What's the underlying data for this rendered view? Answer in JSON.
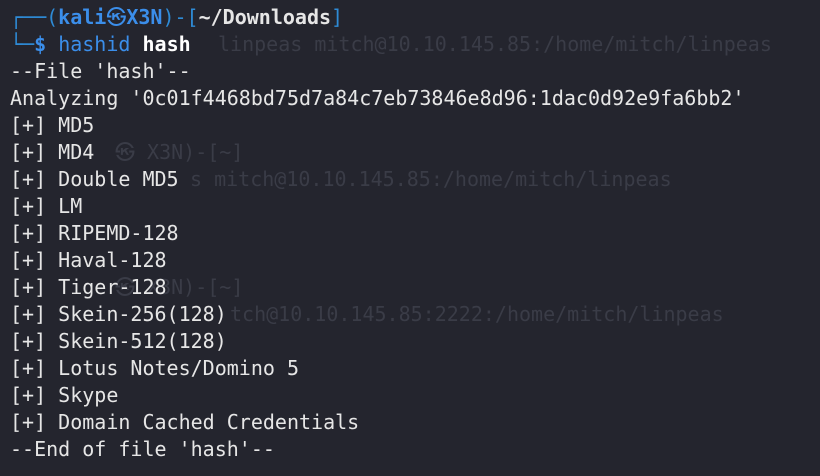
{
  "prompt": {
    "frame_top": "┌──(",
    "user": "kali",
    "at_symbol": "㉿",
    "host": "X3N",
    "frame_mid": ")-[",
    "path": "~/Downloads",
    "frame_end": "]",
    "frame_bottom": "└─",
    "dollar": "$",
    "command": "hashid",
    "argument": "hash"
  },
  "output": {
    "file_header": "--File 'hash'--",
    "analyzing": "Analyzing '0c01f4468bd75d7a84c7eb73846e8d96:1dac0d92e9fa6bb2'",
    "marker": "[+]",
    "results": [
      "MD5",
      "MD4",
      "Double MD5",
      "LM",
      "RIPEMD-128",
      "Haval-128",
      "Tiger-128",
      "Skein-256(128)",
      "Skein-512(128)",
      "Lotus Notes/Domino 5",
      "Skype",
      "Domain Cached Credentials"
    ],
    "file_footer": "--End of file 'hash'--"
  },
  "ghost_text": {
    "line1": "linpeas mitch@10.10.145.85:/home/mitch/linpeas",
    "line2": "㉿ X3N)-[~]",
    "line3": "s mitch@10.10.145.85:/home/mitch/linpeas",
    "line4": "㉿ X3N)-[~]",
    "line5": "tch@10.10.145.85:2222:/home/mitch/linpeas"
  },
  "colors": {
    "background": "#24252e",
    "prompt_blue": "#3b8eea",
    "text": "#e6e6e6"
  }
}
